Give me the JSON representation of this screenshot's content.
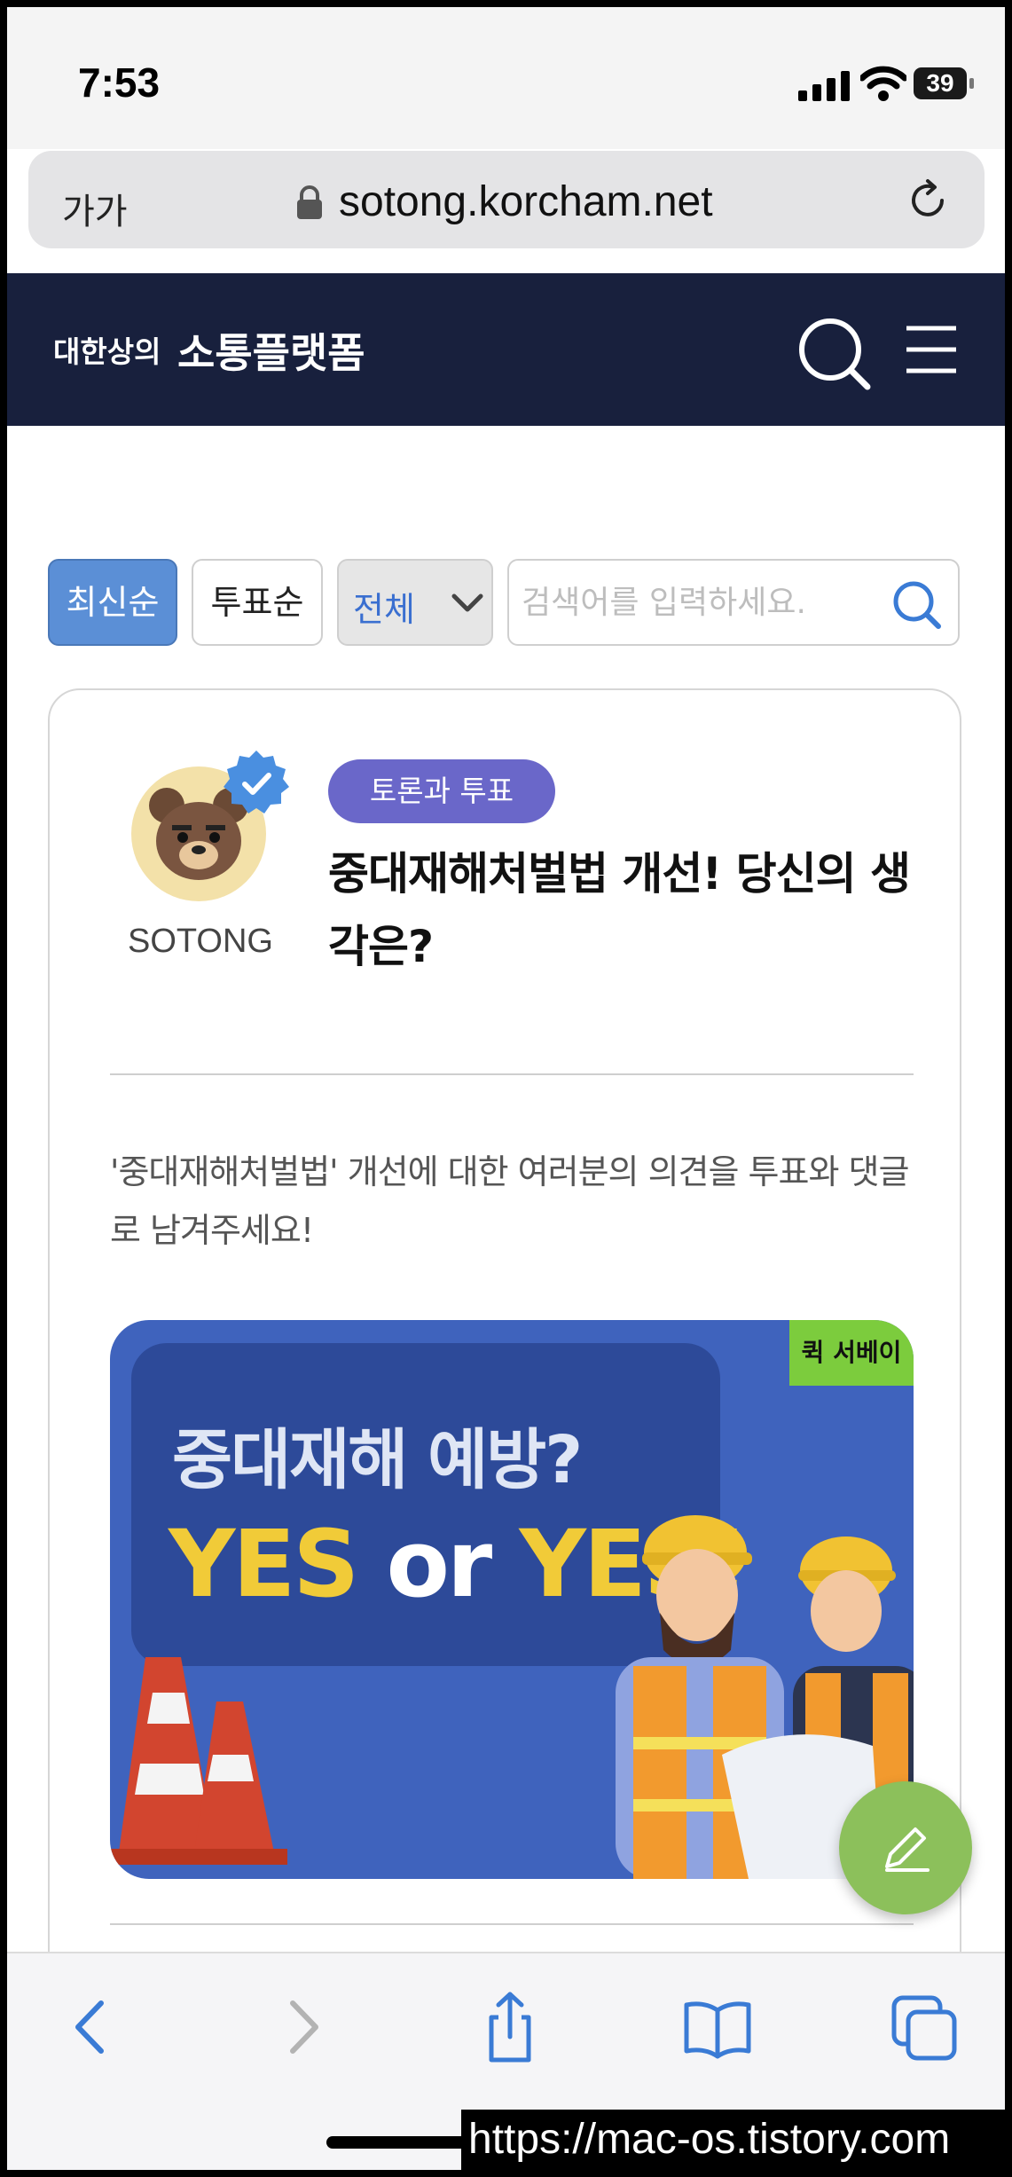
{
  "status_bar": {
    "time": "7:53",
    "battery": "39"
  },
  "browser": {
    "aa_label": "가가",
    "url": "sotong.korcham.net"
  },
  "header": {
    "brand_small": "대한상의",
    "brand_big": "소통플랫폼"
  },
  "filters": {
    "latest_label": "최신순",
    "vote_label": "투표순",
    "category_selected": "전체",
    "search_placeholder": "검색어를 입력하세요."
  },
  "post": {
    "author": "SOTONG",
    "tag": "토론과 투표",
    "title": "중대재해처벌법 개선! 당신의 생각은?",
    "description": "'중대재해처벌법' 개선에 대한 여러분의 의견을 투표와 댓글로 남겨주세요!",
    "banner": {
      "corner_tag": "퀵 서베이",
      "headline": "중대재해 예방?",
      "yes1": "YES",
      "or": "or",
      "yes2": "YES!"
    }
  },
  "watermark": "https://mac-os.tistory.com",
  "colors": {
    "header_bg": "#18203d",
    "active_filter": "#5b8fd6",
    "tag_bg": "#6a67c9",
    "fab": "#8cc05b",
    "banner_bg": "#3f63bd",
    "banner_yes": "#f1cb38",
    "safari_blue": "#3a7bd5"
  }
}
